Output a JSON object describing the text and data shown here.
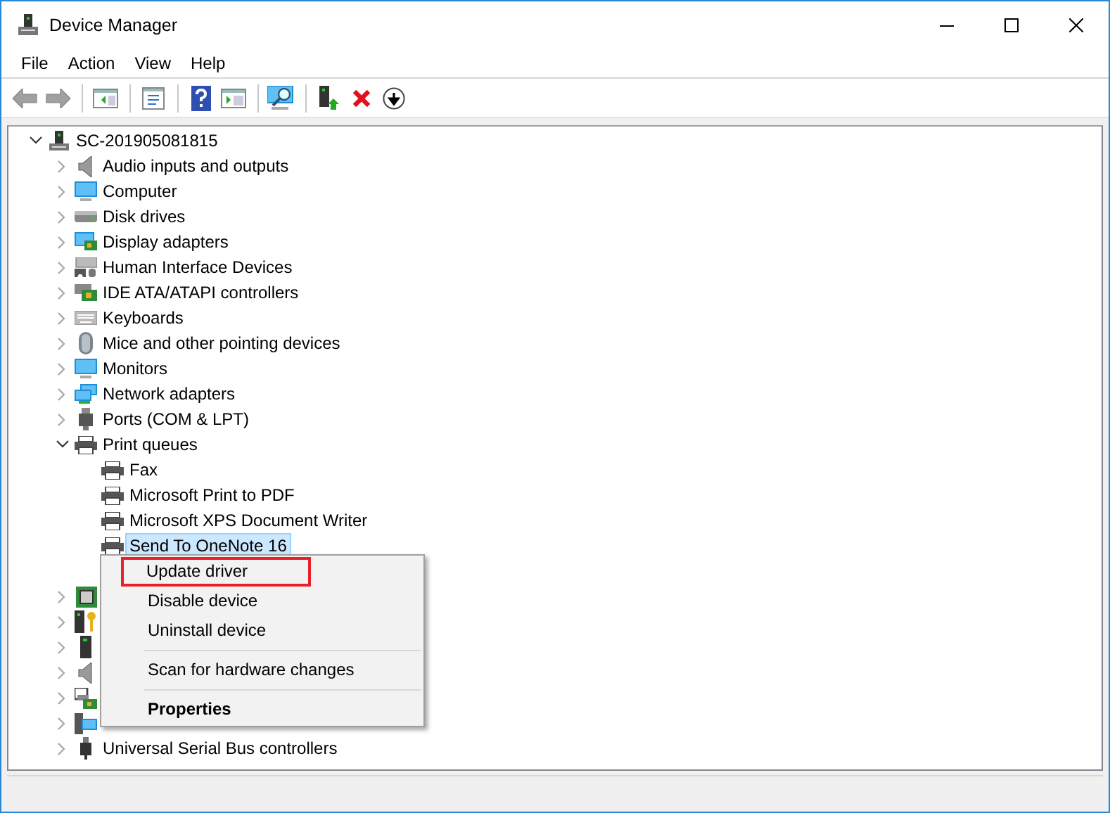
{
  "window": {
    "title": "Device Manager"
  },
  "menu_bar": [
    "File",
    "Action",
    "View",
    "Help"
  ],
  "toolbar": [
    {
      "kind": "back",
      "disabled": true
    },
    {
      "kind": "forward",
      "disabled": true
    },
    {
      "kind": "separator"
    },
    {
      "kind": "console-tree"
    },
    {
      "kind": "separator"
    },
    {
      "kind": "properties"
    },
    {
      "kind": "separator"
    },
    {
      "kind": "help"
    },
    {
      "kind": "action-pane"
    },
    {
      "kind": "separator"
    },
    {
      "kind": "scan"
    },
    {
      "kind": "separator"
    },
    {
      "kind": "update"
    },
    {
      "kind": "uninstall"
    },
    {
      "kind": "disable"
    }
  ],
  "tree": {
    "label": "SC-201905081815",
    "expanded": true,
    "selected": false,
    "children": [
      {
        "label": "Audio inputs and outputs",
        "expanded": false,
        "selected": false
      },
      {
        "label": "Computer",
        "expanded": false,
        "selected": false
      },
      {
        "label": "Disk drives",
        "expanded": false,
        "selected": false
      },
      {
        "label": "Display adapters",
        "expanded": false,
        "selected": false
      },
      {
        "label": "Human Interface Devices",
        "expanded": false,
        "selected": false
      },
      {
        "label": "IDE ATA/ATAPI controllers",
        "expanded": false,
        "selected": false
      },
      {
        "label": "Keyboards",
        "expanded": false,
        "selected": false
      },
      {
        "label": "Mice and other pointing devices",
        "expanded": false,
        "selected": false
      },
      {
        "label": "Monitors",
        "expanded": false,
        "selected": false
      },
      {
        "label": "Network adapters",
        "expanded": false,
        "selected": false
      },
      {
        "label": "Ports (COM & LPT)",
        "expanded": false,
        "selected": false
      },
      {
        "label": "Print queues",
        "expanded": true,
        "selected": false,
        "children": [
          {
            "label": "Fax",
            "selected": false
          },
          {
            "label": "Microsoft Print to PDF",
            "selected": false
          },
          {
            "label": "Microsoft XPS Document Writer",
            "selected": false
          },
          {
            "label": "Send To OneNote 16",
            "selected": true
          },
          {
            "selected": false
          }
        ]
      },
      {
        "expanded": false,
        "selected": false
      },
      {
        "expanded": false,
        "selected": false
      },
      {
        "expanded": false,
        "selected": false
      },
      {
        "expanded": false,
        "selected": false
      },
      {
        "expanded": false,
        "selected": false
      },
      {
        "expanded": false,
        "selected": false
      },
      {
        "label": "Universal Serial Bus controllers",
        "expanded": false,
        "selected": false
      }
    ]
  },
  "context_menu": [
    {
      "kind": "item",
      "label": "Update driver",
      "default": false,
      "annotated": true
    },
    {
      "kind": "item",
      "label": "Disable device",
      "default": false,
      "annotated": false
    },
    {
      "kind": "item",
      "label": "Uninstall device",
      "default": false,
      "annotated": false
    },
    {
      "kind": "separator"
    },
    {
      "kind": "item",
      "label": "Scan for hardware changes",
      "default": false,
      "annotated": false
    },
    {
      "kind": "separator"
    },
    {
      "kind": "item",
      "label": "Properties",
      "default": true,
      "annotated": false
    }
  ]
}
